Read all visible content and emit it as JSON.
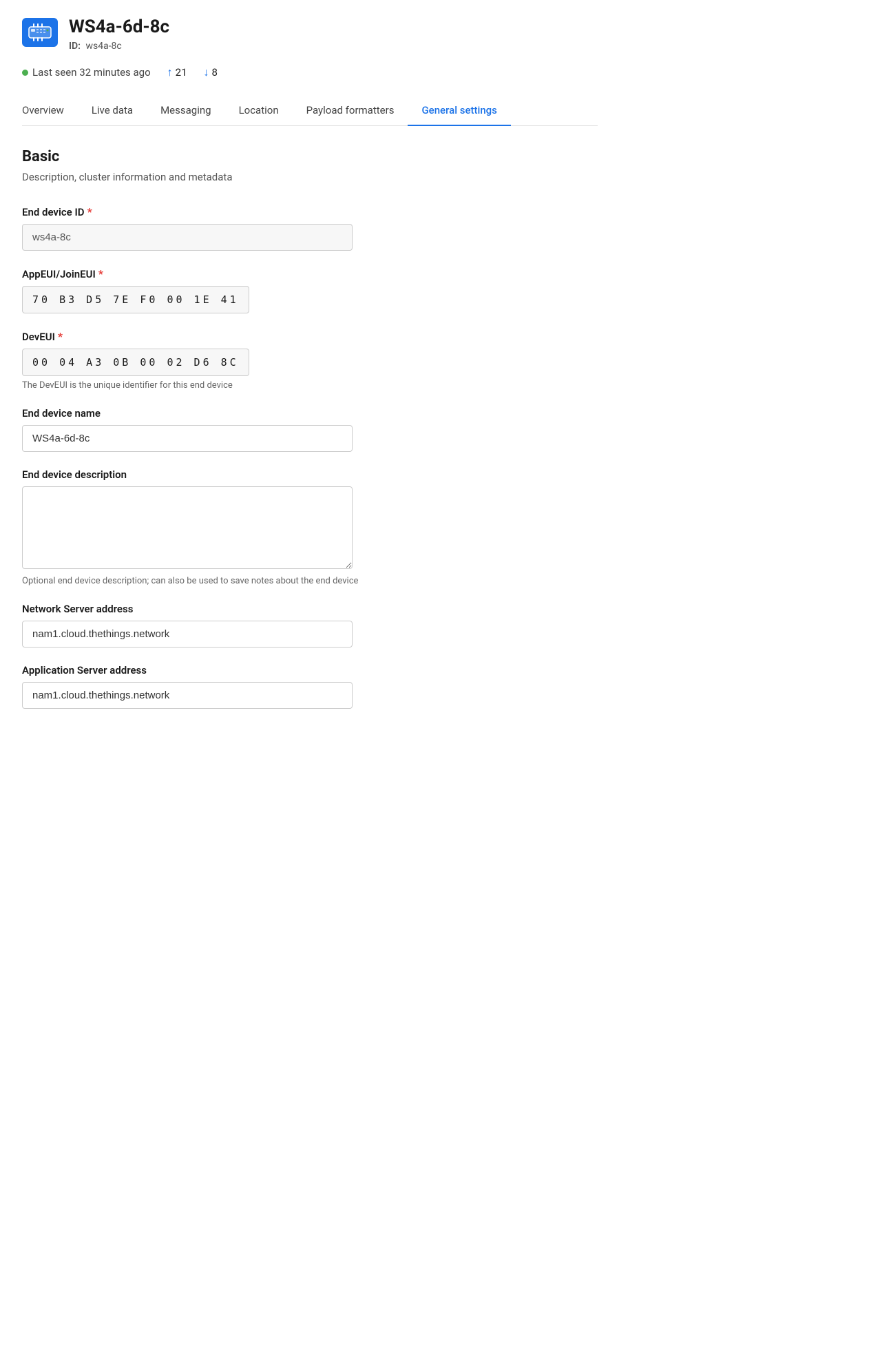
{
  "header": {
    "device_name": "WS4a-6d-8c",
    "device_id_label": "ID:",
    "device_id_value": "ws4a-8c",
    "icon_alt": "device-icon"
  },
  "status": {
    "last_seen_label": "Last seen 32 minutes ago",
    "upload_count": "21",
    "download_count": "8"
  },
  "nav": {
    "tabs": [
      {
        "id": "overview",
        "label": "Overview",
        "active": false
      },
      {
        "id": "live-data",
        "label": "Live data",
        "active": false
      },
      {
        "id": "messaging",
        "label": "Messaging",
        "active": false
      },
      {
        "id": "location",
        "label": "Location",
        "active": false
      },
      {
        "id": "payload-formatters",
        "label": "Payload formatters",
        "active": false
      },
      {
        "id": "general-settings",
        "label": "General settings",
        "active": true
      }
    ]
  },
  "basic_section": {
    "title": "Basic",
    "description": "Description, cluster information and metadata"
  },
  "fields": {
    "end_device_id": {
      "label": "End device ID",
      "required": true,
      "value": "ws4a-8c",
      "hint": ""
    },
    "app_eui": {
      "label": "AppEUI/JoinEUI",
      "required": true,
      "value": "70  B3  D5  7E  F0  00  1E  41",
      "hint": ""
    },
    "dev_eui": {
      "label": "DevEUI",
      "required": true,
      "value": "00  04  A3  0B  00  02  D6  8C",
      "hint": "The DevEUI is the unique identifier for this end device"
    },
    "end_device_name": {
      "label": "End device name",
      "required": false,
      "value": "WS4a-6d-8c",
      "hint": ""
    },
    "end_device_description": {
      "label": "End device description",
      "required": false,
      "value": "",
      "placeholder": "",
      "hint": "Optional end device description; can also be used to save notes about the end device"
    },
    "network_server_address": {
      "label": "Network Server address",
      "required": false,
      "value": "nam1.cloud.thethings.network",
      "hint": ""
    },
    "application_server_address": {
      "label": "Application Server address",
      "required": false,
      "value": "nam1.cloud.thethings.network",
      "hint": ""
    }
  }
}
